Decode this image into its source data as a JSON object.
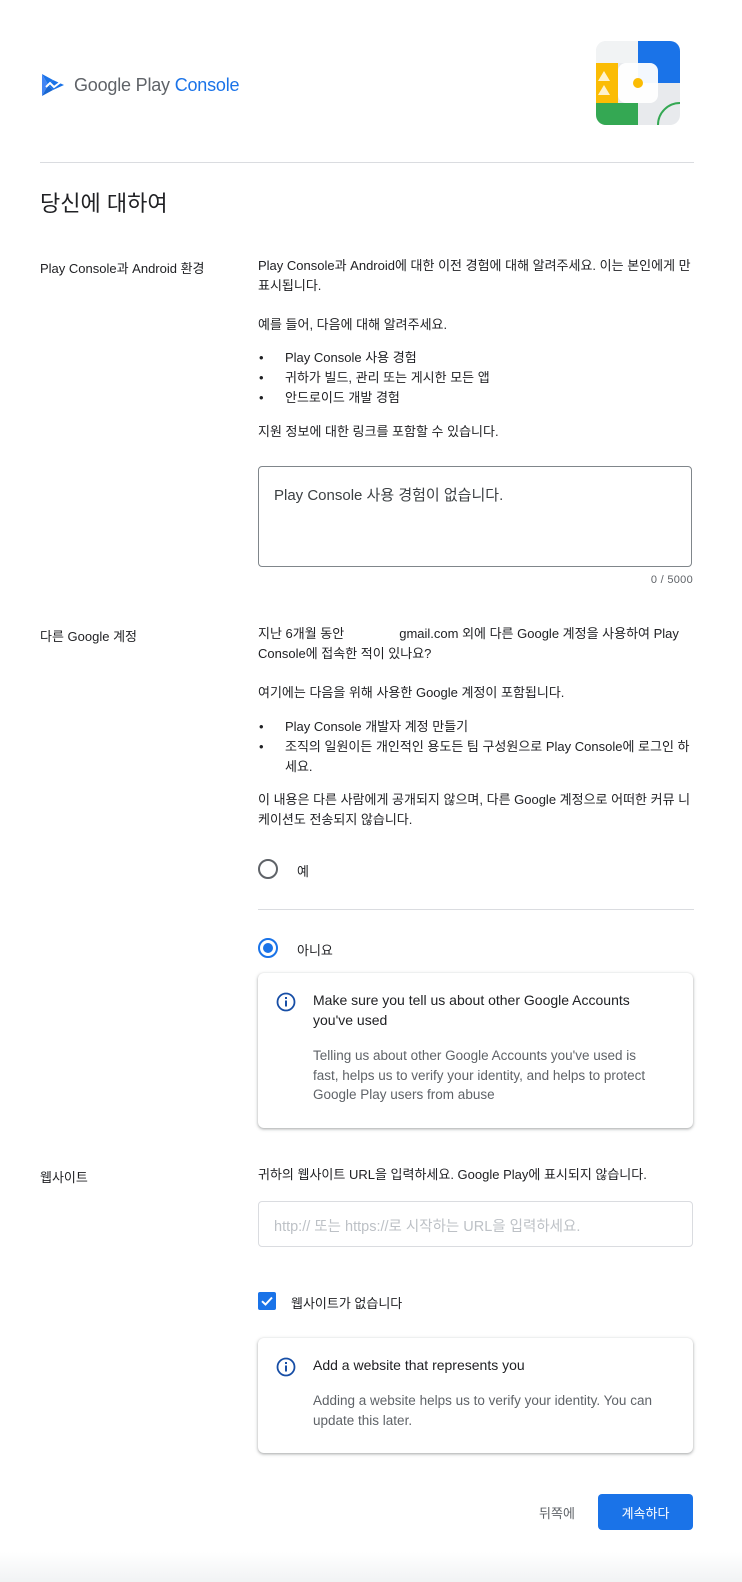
{
  "header": {
    "logo_google_play": "Google Play",
    "logo_console": "Console"
  },
  "page": {
    "title": "당신에 대하여"
  },
  "experience": {
    "label": "Play Console과 Android 환경",
    "intro": "Play Console과 Android에 대한 이전 경험에 대해 알려주세요. 이는 본인에게 만 표시됩니다.",
    "example_lead": "예를 들어, 다음에 대해 알려주세요.",
    "bullets": [
      "Play Console 사용 경험",
      "귀하가 빌드, 관리 또는 게시한 모든 앱",
      "안드로이드 개발 경험"
    ],
    "support_note": "지원 정보에 대한 링크를 포함할 수 있습니다.",
    "textarea_value": "Play Console 사용 경험이 없습니다.",
    "counter": "0 / 5000"
  },
  "other_accounts": {
    "label": "다른 Google 계정",
    "question_part1": "지난 6개월 동안",
    "question_part2": "gmail.com 외에 다른 Google 계정을 사용하여 Play Console에 접속한 적이 있나요?",
    "includes_lead": "여기에는 다음을 위해 사용한 Google 계정이 포함됩니다.",
    "bullets": [
      "Play Console 개발자 계정 만들기",
      "조직의 일원이든 개인적인 용도든 팀 구성원으로 Play Console에 로그인 하세요."
    ],
    "privacy_note": "이 내용은 다른 사람에게 공개되지 않으며, 다른 Google 계정으로 어떠한 커뮤 니케이션도 전송되지 않습니다.",
    "option_yes": "예",
    "option_no": "아니요",
    "selected": "no",
    "info_title": "Make sure you tell us about other Google Accounts you've used",
    "info_body": "Telling us about other Google Accounts you've used is fast, helps us to verify your identity, and helps to protect Google Play users from abuse"
  },
  "website": {
    "label": "웹사이트",
    "description": "귀하의 웹사이트 URL을 입력하세요. Google Play에 표시되지 않습니다.",
    "placeholder": "http:// 또는 https://로 시작하는 URL을 입력하세요.",
    "no_website_label": "웹사이트가 없습니다",
    "no_website_checked": true,
    "info_title": "Add a website that represents you",
    "info_body": "Adding a website helps us to verify your identity. You can update this later."
  },
  "footer": {
    "back_label": "뒤쪽에",
    "continue_label": "계속하다"
  },
  "colors": {
    "primary": "#1a73e8",
    "text": "#202124",
    "secondary": "#5f6368",
    "divider": "#dadce0"
  },
  "icons": [
    "google-play-console-logo-icon",
    "info-icon",
    "check-icon"
  ]
}
